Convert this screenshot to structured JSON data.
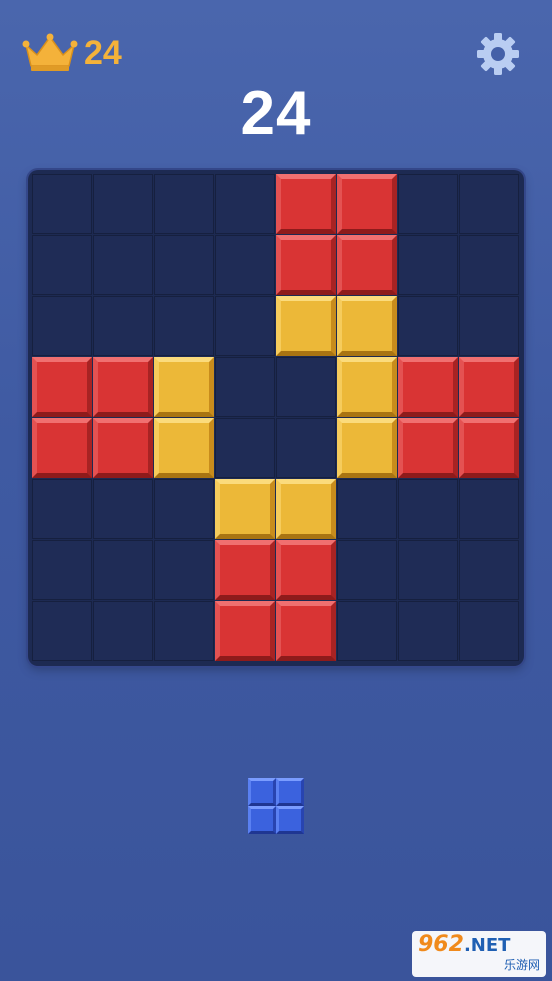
{
  "header": {
    "best_score": "24",
    "best_icon": "crown-icon",
    "settings_icon": "gear-icon"
  },
  "score": "24",
  "board": {
    "rows": 8,
    "cols": 8,
    "grid": [
      "....RR..",
      "....RR..",
      "....YY..",
      "RRY..YRR",
      "RRY..YRR",
      "...YY...",
      "...RR...",
      "...RR..."
    ],
    "legend": {
      "R": "red-block",
      "Y": "yellow-block",
      ".": "empty"
    }
  },
  "tray": {
    "pieces": [
      {
        "shape": "2x2 square",
        "color": "blue",
        "cells": [
          [
            0,
            0
          ],
          [
            0,
            1
          ],
          [
            1,
            0
          ],
          [
            1,
            1
          ]
        ]
      }
    ]
  },
  "watermark": {
    "main": "962",
    "net": ".NET",
    "sub": "乐游网"
  },
  "colors": {
    "background": "#4060a8",
    "board": "#1d2a52",
    "red": "#d93434",
    "yellow": "#ecb838",
    "blue": "#3b62de",
    "best_score": "#f4b23a"
  }
}
